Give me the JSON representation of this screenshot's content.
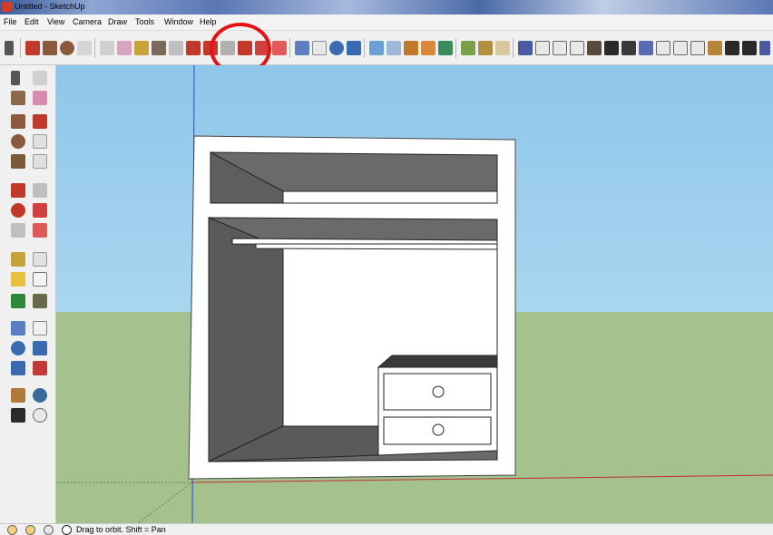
{
  "window": {
    "title": "Untitled - SketchUp"
  },
  "menu": [
    "File",
    "Edit",
    "View",
    "Camera",
    "Draw",
    "Tools",
    "Window",
    "Help"
  ],
  "toolbar": {
    "icons": [
      "select-icon",
      "line-icon",
      "rectangle-icon",
      "circle-icon",
      "arc-icon",
      "make-component-icon",
      "paint-bucket-icon",
      "tape-measure-icon",
      "eraser-icon",
      "push-pull-icon",
      "offset-icon",
      "rotate-icon",
      "follow-me-icon",
      "orbit-icon",
      "pan-icon",
      "zoom-icon",
      "zoom-extents-icon",
      "previous-view-icon",
      "next-view-icon",
      "position-camera-icon",
      "walk-icon",
      "look-around-icon",
      "add-location-icon",
      "toggle-terrain-icon",
      "photo-textures-icon",
      "iso-view-icon",
      "top-view-icon",
      "front-view-icon",
      "right-view-icon",
      "back-view-icon",
      "left-view-icon"
    ]
  },
  "left_toolbar": {
    "icons": [
      "select-icon",
      "make-component-icon",
      "paint-bucket-icon",
      "eraser-icon",
      "rectangle-icon",
      "line-icon",
      "circle-icon",
      "arc-icon",
      "polygon-icon",
      "freehand-icon",
      "move-icon",
      "push-pull-icon",
      "rotate-icon",
      "follow-me-icon",
      "scale-icon",
      "offset-icon",
      "tape-measure-icon",
      "dimension-icon",
      "protractor-icon",
      "text-icon",
      "axes-icon",
      "3d-text-icon",
      "orbit-icon",
      "pan-icon",
      "zoom-icon",
      "zoom-window-icon",
      "zoom-extents-icon",
      "previous-view-icon",
      "position-camera-icon",
      "look-around-icon",
      "walk-icon",
      "section-plane-icon"
    ]
  },
  "status": {
    "text": "Drag to orbit.  Shift = Pan"
  },
  "colors": {
    "sky": "#9fd0ee",
    "ground": "#a5c18e",
    "highlight": "#e41414",
    "model_gray": "#6a6a6a"
  }
}
